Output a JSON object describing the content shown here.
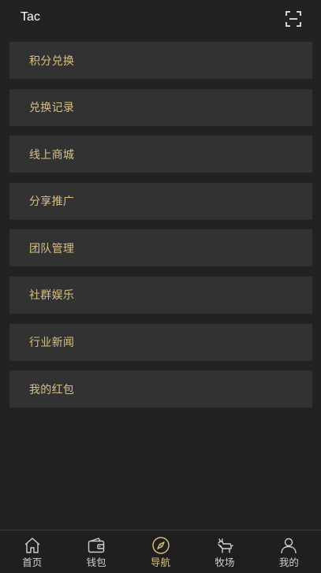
{
  "header": {
    "title": "Tac",
    "scan_icon": "scan-icon"
  },
  "menu": [
    {
      "label": "积分兑换"
    },
    {
      "label": "兑换记录"
    },
    {
      "label": "线上商城"
    },
    {
      "label": "分享推广"
    },
    {
      "label": "团队管理"
    },
    {
      "label": "社群娱乐"
    },
    {
      "label": "行业新闻"
    },
    {
      "label": "我的红包"
    }
  ],
  "tabs": [
    {
      "label": "首页",
      "icon": "home-icon",
      "active": false
    },
    {
      "label": "钱包",
      "icon": "wallet-icon",
      "active": false
    },
    {
      "label": "导航",
      "icon": "compass-icon",
      "active": true
    },
    {
      "label": "牧场",
      "icon": "goat-icon",
      "active": false
    },
    {
      "label": "我的",
      "icon": "user-icon",
      "active": false
    }
  ],
  "colors": {
    "background": "#222222",
    "menu_item_bg": "#323232",
    "accent_gold": "#d8c084",
    "tab_inactive": "#cfcfcf"
  }
}
